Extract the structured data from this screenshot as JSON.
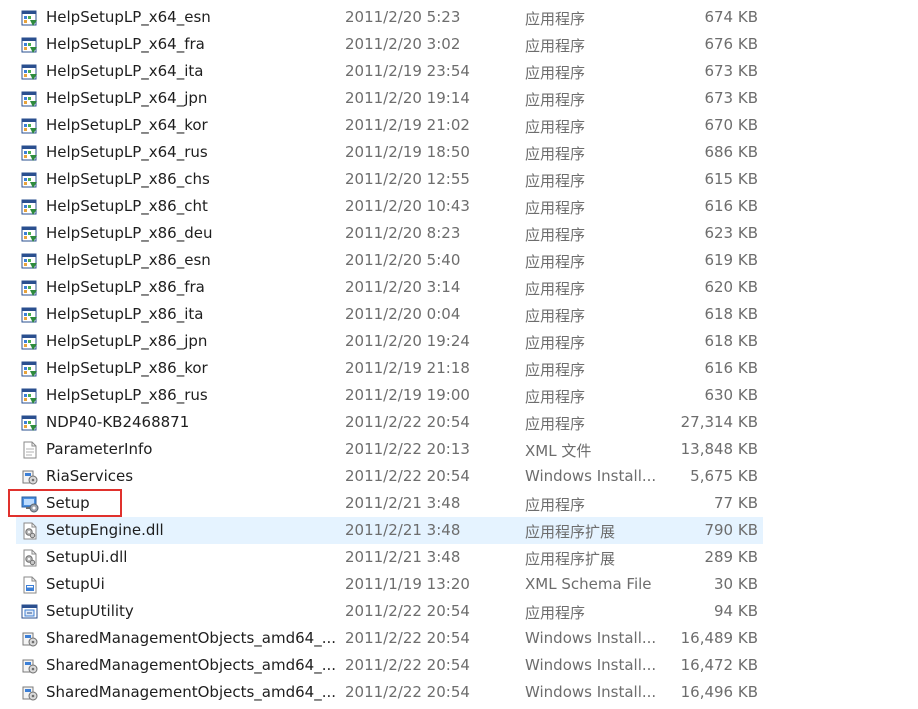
{
  "colors": {
    "hover_row": "#e5f3ff",
    "highlight_box": "#e0312d",
    "text_primary": "#1e1e1e",
    "text_secondary": "#6d6d6d"
  },
  "files": [
    {
      "name": "HelpSetupLP_x64_esn",
      "date": "2011/2/20 5:23",
      "type": "应用程序",
      "size": "674 KB",
      "icon": "installer-exe-icon"
    },
    {
      "name": "HelpSetupLP_x64_fra",
      "date": "2011/2/20 3:02",
      "type": "应用程序",
      "size": "676 KB",
      "icon": "installer-exe-icon"
    },
    {
      "name": "HelpSetupLP_x64_ita",
      "date": "2011/2/19 23:54",
      "type": "应用程序",
      "size": "673 KB",
      "icon": "installer-exe-icon"
    },
    {
      "name": "HelpSetupLP_x64_jpn",
      "date": "2011/2/20 19:14",
      "type": "应用程序",
      "size": "673 KB",
      "icon": "installer-exe-icon"
    },
    {
      "name": "HelpSetupLP_x64_kor",
      "date": "2011/2/19 21:02",
      "type": "应用程序",
      "size": "670 KB",
      "icon": "installer-exe-icon"
    },
    {
      "name": "HelpSetupLP_x64_rus",
      "date": "2011/2/19 18:50",
      "type": "应用程序",
      "size": "686 KB",
      "icon": "installer-exe-icon"
    },
    {
      "name": "HelpSetupLP_x86_chs",
      "date": "2011/2/20 12:55",
      "type": "应用程序",
      "size": "615 KB",
      "icon": "installer-exe-icon"
    },
    {
      "name": "HelpSetupLP_x86_cht",
      "date": "2011/2/20 10:43",
      "type": "应用程序",
      "size": "616 KB",
      "icon": "installer-exe-icon"
    },
    {
      "name": "HelpSetupLP_x86_deu",
      "date": "2011/2/20 8:23",
      "type": "应用程序",
      "size": "623 KB",
      "icon": "installer-exe-icon"
    },
    {
      "name": "HelpSetupLP_x86_esn",
      "date": "2011/2/20 5:40",
      "type": "应用程序",
      "size": "619 KB",
      "icon": "installer-exe-icon"
    },
    {
      "name": "HelpSetupLP_x86_fra",
      "date": "2011/2/20 3:14",
      "type": "应用程序",
      "size": "620 KB",
      "icon": "installer-exe-icon"
    },
    {
      "name": "HelpSetupLP_x86_ita",
      "date": "2011/2/20 0:04",
      "type": "应用程序",
      "size": "618 KB",
      "icon": "installer-exe-icon"
    },
    {
      "name": "HelpSetupLP_x86_jpn",
      "date": "2011/2/20 19:24",
      "type": "应用程序",
      "size": "618 KB",
      "icon": "installer-exe-icon"
    },
    {
      "name": "HelpSetupLP_x86_kor",
      "date": "2011/2/19 21:18",
      "type": "应用程序",
      "size": "616 KB",
      "icon": "installer-exe-icon"
    },
    {
      "name": "HelpSetupLP_x86_rus",
      "date": "2011/2/19 19:00",
      "type": "应用程序",
      "size": "630 KB",
      "icon": "installer-exe-icon"
    },
    {
      "name": "NDP40-KB2468871",
      "date": "2011/2/22 20:54",
      "type": "应用程序",
      "size": "27,314 KB",
      "icon": "installer-exe-icon"
    },
    {
      "name": "ParameterInfo",
      "date": "2011/2/22 20:13",
      "type": "XML 文件",
      "size": "13,848 KB",
      "icon": "document-icon"
    },
    {
      "name": "RiaServices",
      "date": "2011/2/22 20:54",
      "type": "Windows Install...",
      "size": "5,675 KB",
      "icon": "msi-package-icon"
    },
    {
      "name": "Setup",
      "date": "2011/2/21 3:48",
      "type": "应用程序",
      "size": "77 KB",
      "icon": "setup-exe-icon"
    },
    {
      "name": "SetupEngine.dll",
      "date": "2011/2/21 3:48",
      "type": "应用程序扩展",
      "size": "790 KB",
      "icon": "dll-gear-icon"
    },
    {
      "name": "SetupUi.dll",
      "date": "2011/2/21 3:48",
      "type": "应用程序扩展",
      "size": "289 KB",
      "icon": "dll-gear-icon"
    },
    {
      "name": "SetupUi",
      "date": "2011/1/19 13:20",
      "type": "XML Schema File",
      "size": "30 KB",
      "icon": "xsd-file-icon"
    },
    {
      "name": "SetupUtility",
      "date": "2011/2/22 20:54",
      "type": "应用程序",
      "size": "94 KB",
      "icon": "utility-exe-icon"
    },
    {
      "name": "SharedManagementObjects_amd64_...",
      "date": "2011/2/22 20:54",
      "type": "Windows Install...",
      "size": "16,489 KB",
      "icon": "msi-package-icon"
    },
    {
      "name": "SharedManagementObjects_amd64_...",
      "date": "2011/2/22 20:54",
      "type": "Windows Install...",
      "size": "16,472 KB",
      "icon": "msi-package-icon"
    },
    {
      "name": "SharedManagementObjects_amd64_...",
      "date": "2011/2/22 20:54",
      "type": "Windows Install...",
      "size": "16,496 KB",
      "icon": "msi-package-icon"
    }
  ]
}
